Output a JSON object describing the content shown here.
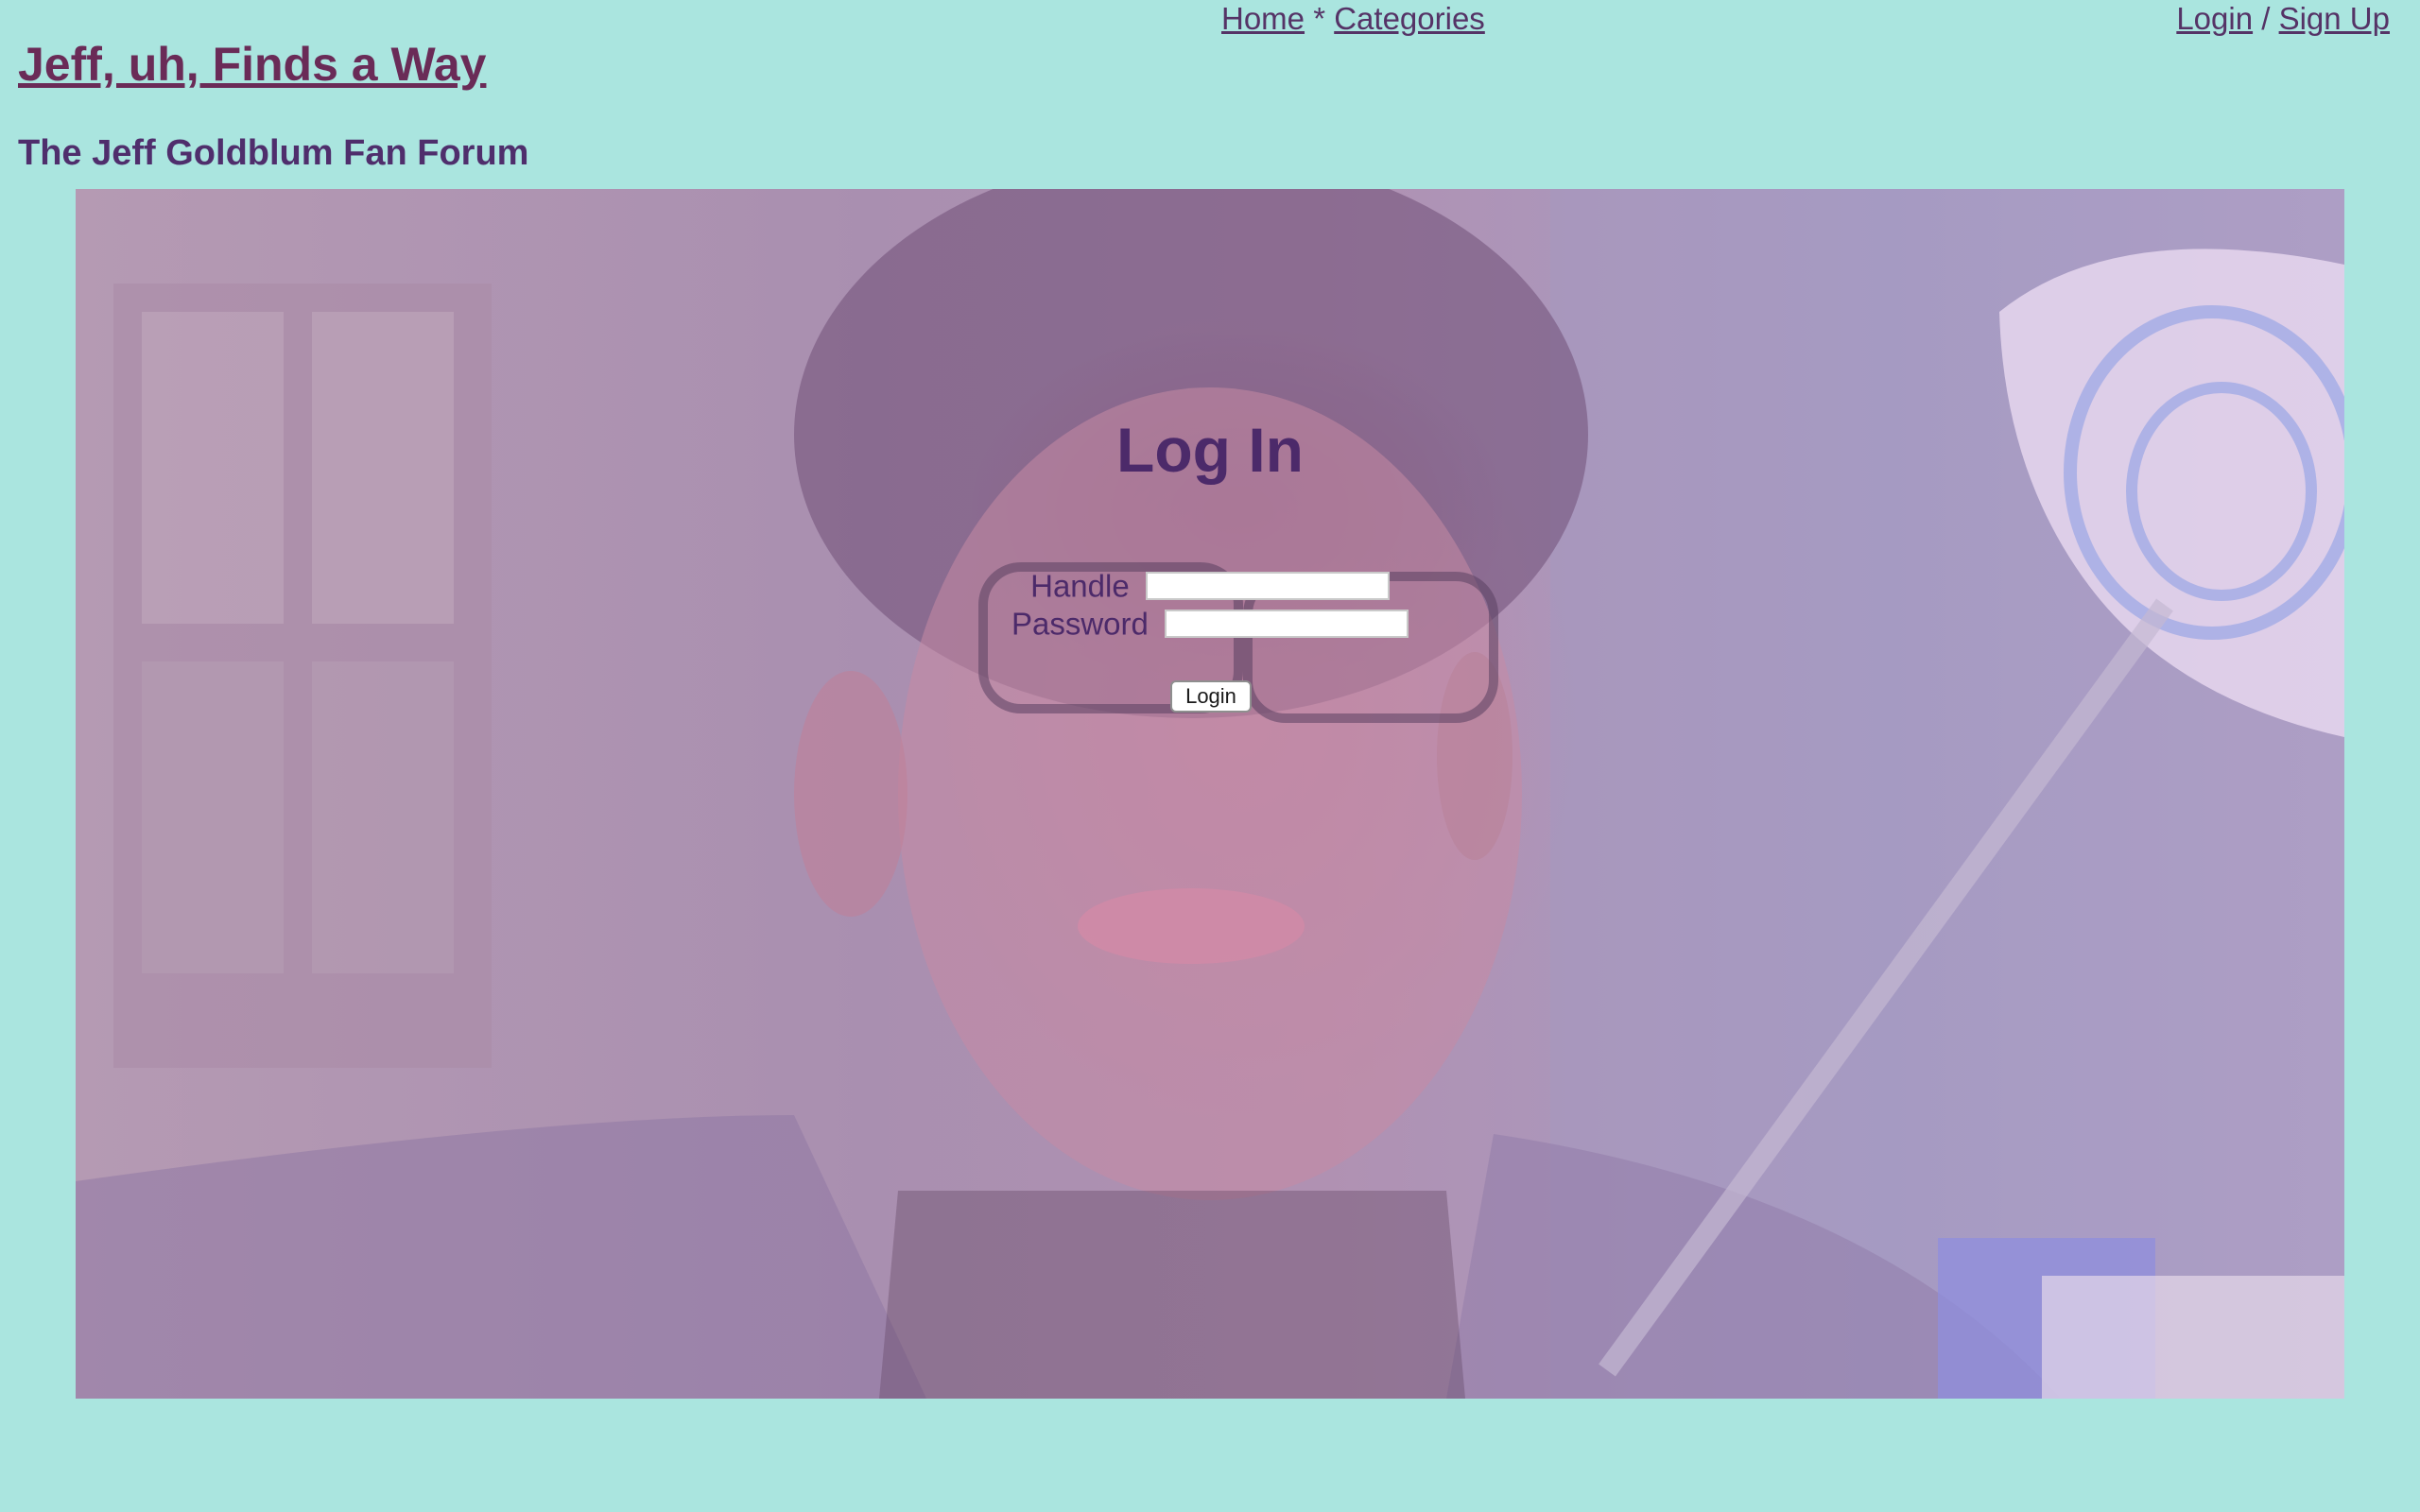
{
  "nav": {
    "home": "Home",
    "separator": "*",
    "categories": "Categories",
    "login": "Login",
    "slash": "/",
    "signup": "Sign Up"
  },
  "header": {
    "title": "Jeff, uh, Finds a Way",
    "subtitle": "The Jeff Goldblum Fan Forum"
  },
  "login_form": {
    "heading": "Log In",
    "handle_label": "Handle",
    "handle_value": "",
    "password_label": "Password",
    "password_value": "",
    "submit_label": "Login"
  },
  "colors": {
    "page_background": "#aae5df",
    "link": "#553366",
    "title": "#6a2b57",
    "heading": "#4c2a6a"
  }
}
